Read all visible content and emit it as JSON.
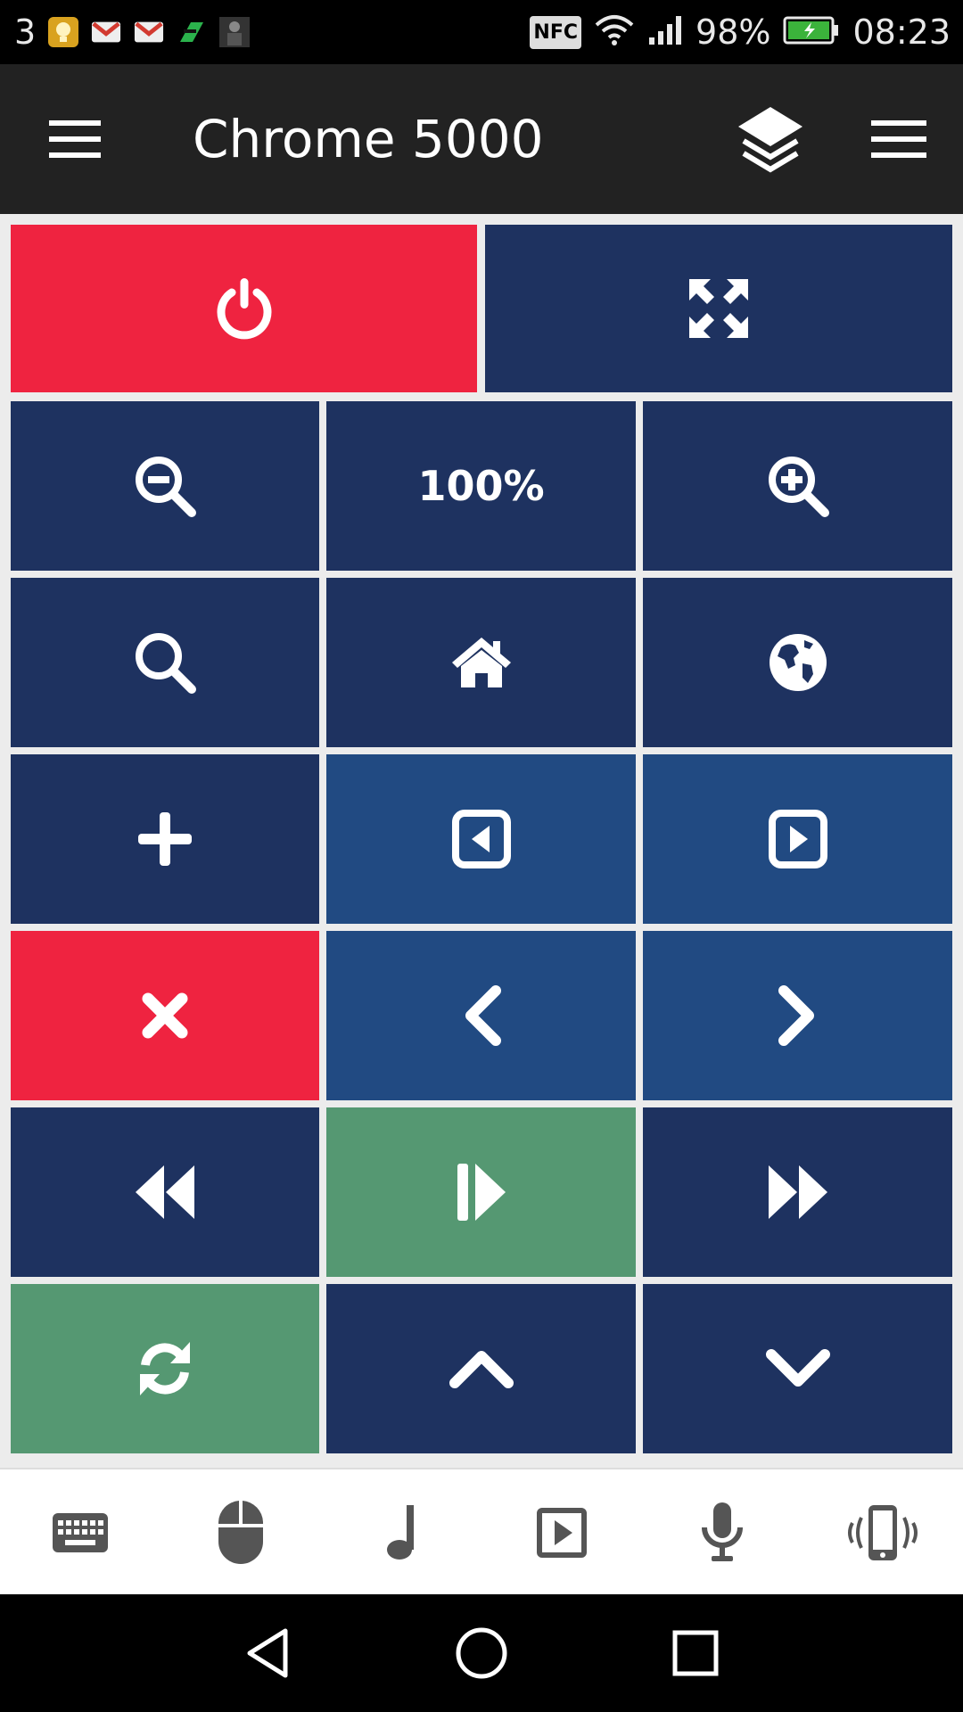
{
  "status_bar": {
    "notification_count": "3",
    "notification_icons": [
      "lightbulb-icon",
      "gmail-icon",
      "gmail-icon",
      "feedly-icon",
      "photo-thumbnail-icon"
    ],
    "nfc": "NFC",
    "battery": "98%",
    "time": "08:23"
  },
  "app_bar": {
    "title": "Chrome 5000"
  },
  "tiles": {
    "zoom_level": "100%"
  },
  "colors": {
    "red": "#ef2340",
    "navy": "#1e3260",
    "blue": "#214a82",
    "green": "#559872",
    "app_bar": "#222222",
    "tab_icon": "#555555"
  },
  "bottom_tabs": [
    "keyboard-icon",
    "mouse-icon",
    "music-note-icon",
    "play-box-icon",
    "microphone-icon",
    "phone-vibrate-icon"
  ]
}
